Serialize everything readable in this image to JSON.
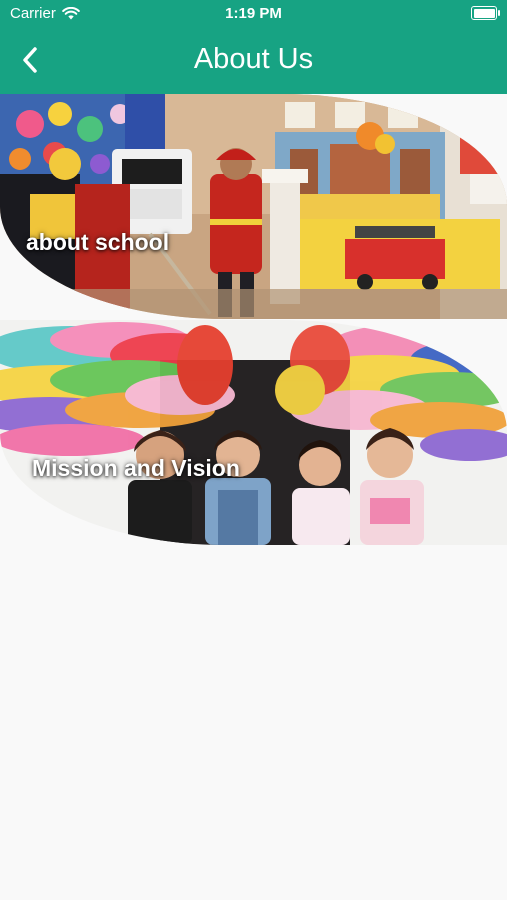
{
  "status_bar": {
    "carrier": "Carrier",
    "time": "1:19 PM",
    "icons": [
      "wifi-icon",
      "battery-icon"
    ]
  },
  "header": {
    "title": "About Us",
    "back_icon": "chevron-left-icon",
    "background_color": "#17a383"
  },
  "cards": [
    {
      "label": "about school"
    },
    {
      "label": "Mission and Vision"
    }
  ]
}
